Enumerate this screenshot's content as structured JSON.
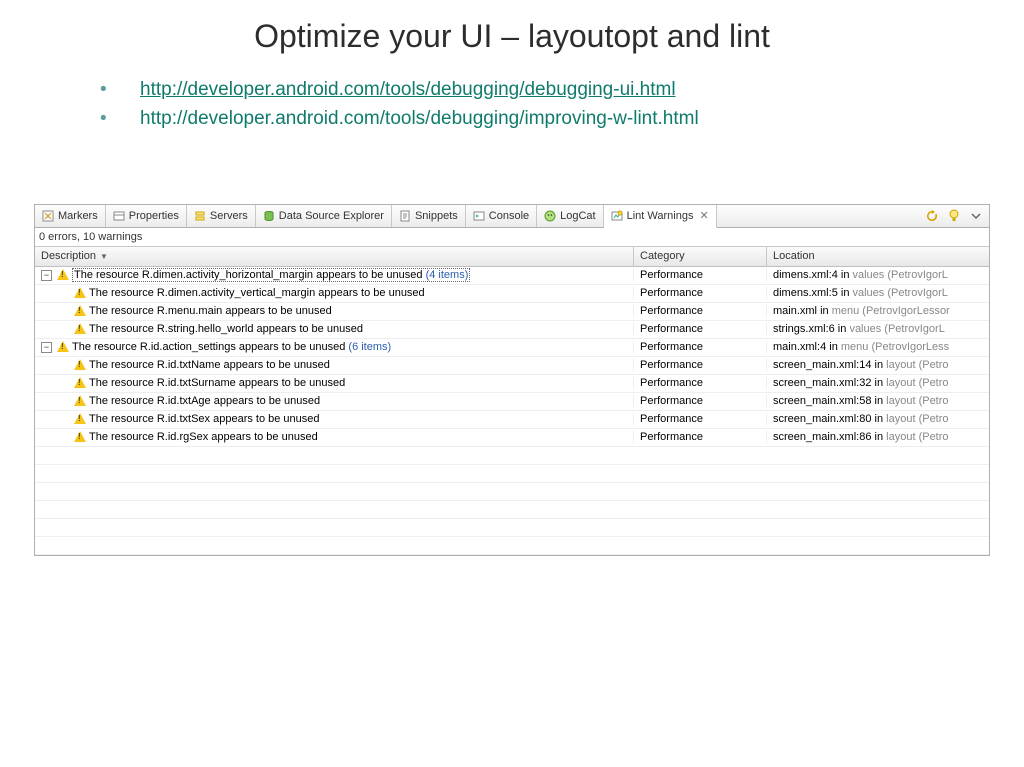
{
  "title": "Optimize your UI – layoutopt and lint",
  "bullets": [
    {
      "text": "http://developer.android.com/tools/debugging/debugging-ui.html",
      "link": true
    },
    {
      "text": "http://developer.android.com/tools/debugging/improving-w-lint.html",
      "link": false
    }
  ],
  "eclipse": {
    "tabs": [
      {
        "icon": "markers-icon",
        "label": "Markers"
      },
      {
        "icon": "properties-icon",
        "label": "Properties"
      },
      {
        "icon": "servers-icon",
        "label": "Servers"
      },
      {
        "icon": "datasource-icon",
        "label": "Data Source Explorer"
      },
      {
        "icon": "snippets-icon",
        "label": "Snippets"
      },
      {
        "icon": "console-icon",
        "label": "Console"
      },
      {
        "icon": "logcat-icon",
        "label": "LogCat"
      },
      {
        "icon": "lint-icon",
        "label": "Lint Warnings",
        "active": true,
        "closable": true
      }
    ],
    "status": "0 errors, 10 warnings",
    "columns": {
      "desc": "Description",
      "cat": "Category",
      "loc": "Location"
    },
    "rows": [
      {
        "indent": 0,
        "toggle": true,
        "desc": "The resource R.dimen.activity_horizontal_margin appears to be unused",
        "count": "(4 items)",
        "selected": true,
        "cat": "Performance",
        "file": "dimens.xml",
        "line": "4",
        "folder": "values",
        "proj": "(PetrovIgorL"
      },
      {
        "indent": 1,
        "desc": "The resource R.dimen.activity_vertical_margin appears to be unused",
        "cat": "Performance",
        "file": "dimens.xml",
        "line": "5",
        "folder": "values",
        "proj": "(PetrovIgorL"
      },
      {
        "indent": 1,
        "desc": "The resource R.menu.main appears to be unused",
        "cat": "Performance",
        "file": "main.xml",
        "folder": "menu",
        "proj": "(PetrovIgorLessor"
      },
      {
        "indent": 1,
        "desc": "The resource R.string.hello_world appears to be unused",
        "cat": "Performance",
        "file": "strings.xml",
        "line": "6",
        "folder": "values",
        "proj": "(PetrovIgorL"
      },
      {
        "indent": 0,
        "toggle": true,
        "desc": "The resource R.id.action_settings appears to be unused",
        "count": "(6 items)",
        "cat": "Performance",
        "file": "main.xml",
        "line": "4",
        "folder": "menu",
        "proj": "(PetrovIgorLess"
      },
      {
        "indent": 1,
        "desc": "The resource R.id.txtName appears to be unused",
        "cat": "Performance",
        "file": "screen_main.xml",
        "line": "14",
        "folder": "layout",
        "proj": "(Petro"
      },
      {
        "indent": 1,
        "desc": "The resource R.id.txtSurname appears to be unused",
        "cat": "Performance",
        "file": "screen_main.xml",
        "line": "32",
        "folder": "layout",
        "proj": "(Petro"
      },
      {
        "indent": 1,
        "desc": "The resource R.id.txtAge appears to be unused",
        "cat": "Performance",
        "file": "screen_main.xml",
        "line": "58",
        "folder": "layout",
        "proj": "(Petro"
      },
      {
        "indent": 1,
        "desc": "The resource R.id.txtSex appears to be unused",
        "cat": "Performance",
        "file": "screen_main.xml",
        "line": "80",
        "folder": "layout",
        "proj": "(Petro"
      },
      {
        "indent": 1,
        "desc": "The resource R.id.rgSex appears to be unused",
        "cat": "Performance",
        "file": "screen_main.xml",
        "line": "86",
        "folder": "layout",
        "proj": "(Petro"
      }
    ],
    "empty_rows": 6
  }
}
